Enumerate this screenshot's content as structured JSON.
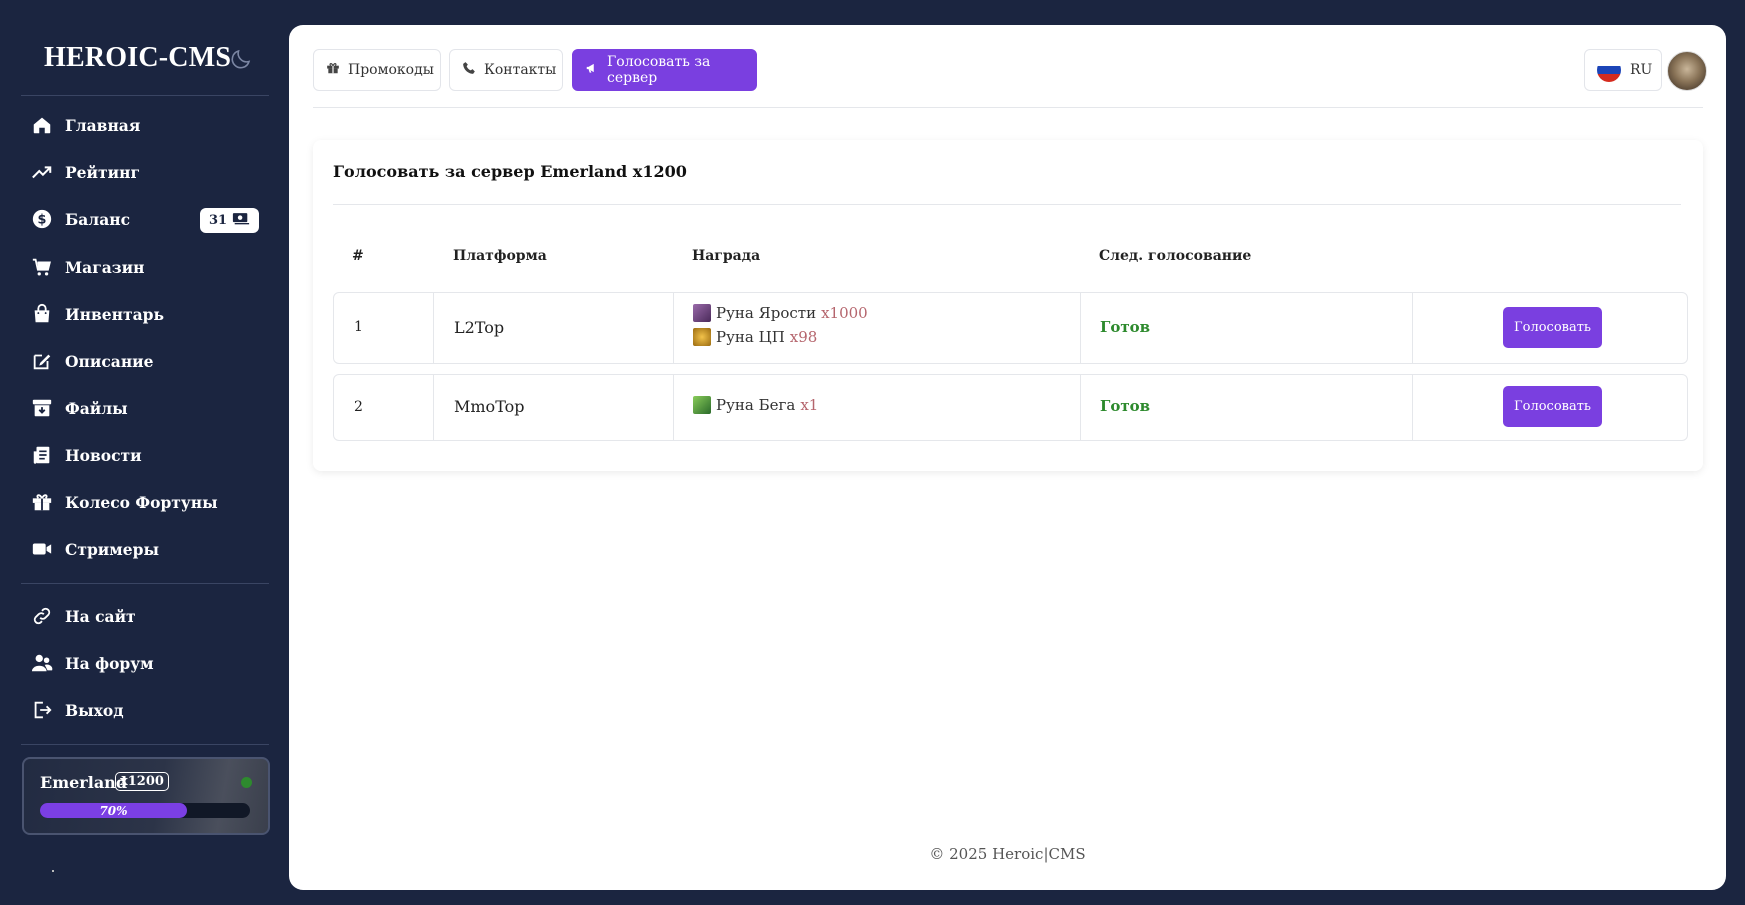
{
  "sidebar": {
    "brand": "HEROIC-CMS",
    "items": [
      {
        "label": "Главная",
        "icon": "home-icon"
      },
      {
        "label": "Рейтинг",
        "icon": "trending-up-icon"
      },
      {
        "label": "Баланс",
        "icon": "dollar-circle-icon"
      },
      {
        "label": "Магазин",
        "icon": "cart-icon"
      },
      {
        "label": "Инвентарь",
        "icon": "shopping-bag-icon"
      },
      {
        "label": "Описание",
        "icon": "edit-icon"
      },
      {
        "label": "Файлы",
        "icon": "archive-download-icon"
      },
      {
        "label": "Новости",
        "icon": "news-icon"
      },
      {
        "label": "Колесо Фортуны",
        "icon": "gift-icon"
      },
      {
        "label": "Стримеры",
        "icon": "video-icon"
      }
    ],
    "balance_badge": "31",
    "links": [
      {
        "label": "На сайт",
        "icon": "link-icon"
      },
      {
        "label": "На форум",
        "icon": "users-icon"
      },
      {
        "label": "Выход",
        "icon": "logout-icon"
      }
    ],
    "server": {
      "name": "Emerland",
      "rate": "x1200",
      "progress_label": "70%",
      "progress": 70
    }
  },
  "topbar": {
    "promo_label": "Промокоды",
    "contacts_label": "Контакты",
    "vote_label": "Голосовать за сервер",
    "lang_label": "RU"
  },
  "vote": {
    "title": "Голосовать за сервер Emerland x1200",
    "columns": [
      "#",
      "Платформа",
      "Награда",
      "След. голосование"
    ],
    "rows": [
      {
        "num": "1",
        "platform": "L2Top",
        "rewards": [
          {
            "name": "Руна Ярости",
            "qty": "x1000",
            "color": "#6a3a7a"
          },
          {
            "name": "Руна ЦП",
            "qty": "x98",
            "color": "#c8931e"
          }
        ],
        "status": "Готов",
        "button": "Голосовать"
      },
      {
        "num": "2",
        "platform": "MmoTop",
        "rewards": [
          {
            "name": "Руна Бега",
            "qty": "x1",
            "color": "#3a8a3a"
          }
        ],
        "status": "Готов",
        "button": "Голосовать"
      }
    ]
  },
  "footer": "© 2025 Heroic|CMS",
  "colors": {
    "sidebar_bg": "#1b2540",
    "accent": "#7a3fe0",
    "status_ok": "#2d8a2d",
    "reward_qty": "#b5656d"
  }
}
